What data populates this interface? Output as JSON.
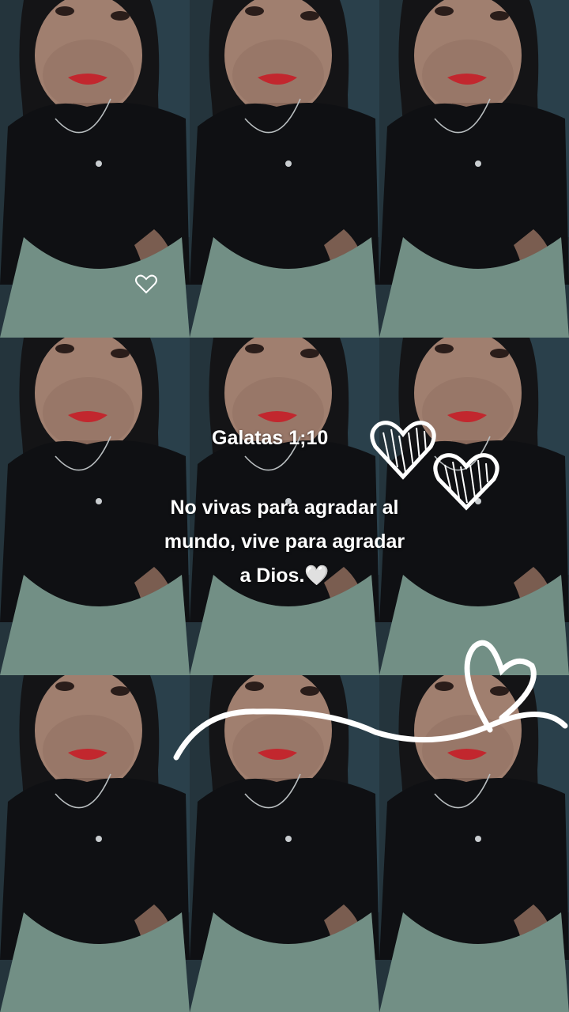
{
  "verse": {
    "reference": "Galatas 1;10",
    "line1": "No vivas para agradar al",
    "line2": "mundo, vive para agradar",
    "line3": "a Dios.",
    "emoji": "🤍"
  },
  "icons": [
    "heart-outline-icon",
    "heart-scribble-icon",
    "heart-swirl-icon"
  ],
  "colors": {
    "background": "#1c2a33",
    "shirt": "#0f1013",
    "skin": "#a07f6f",
    "lips": "#c2272e",
    "text": "#ffffff"
  }
}
